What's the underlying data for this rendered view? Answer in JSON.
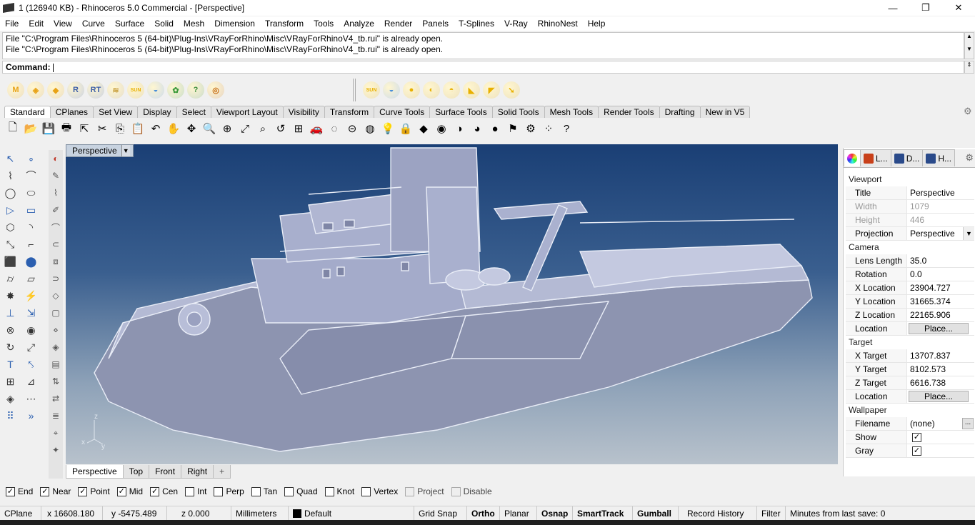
{
  "window": {
    "title": "1 (126940 KB) - Rhinoceros 5.0 Commercial - [Perspective]",
    "minimize": "—",
    "restore": "❐",
    "close": "✕"
  },
  "menu": [
    "File",
    "Edit",
    "View",
    "Curve",
    "Surface",
    "Solid",
    "Mesh",
    "Dimension",
    "Transform",
    "Tools",
    "Analyze",
    "Render",
    "Panels",
    "T-Splines",
    "V-Ray",
    "RhinoNest",
    "Help"
  ],
  "history": [
    "File \"C:\\Program Files\\Rhinoceros 5 (64-bit)\\Plug-Ins\\VRayForRhino\\Misc\\VRayForRhinoV4_tb.rui\" is already open.",
    "File \"C:\\Program Files\\Rhinoceros 5 (64-bit)\\Plug-Ins\\VRayForRhino\\Misc\\VRayForRhinoV4_tb.rui\" is already open."
  ],
  "command": {
    "label": "Command:",
    "value": ""
  },
  "plugin_toolbar_left": [
    {
      "name": "vray-m-icon",
      "glyph": "M",
      "color": "#e8a317"
    },
    {
      "name": "vray-material-icon",
      "glyph": "◈",
      "color": "#e8a317"
    },
    {
      "name": "vray-tag-icon",
      "glyph": "◆",
      "color": "#e8a317"
    },
    {
      "name": "vray-render-icon",
      "glyph": "R",
      "color": "#3d5fa8"
    },
    {
      "name": "vray-rt-icon",
      "glyph": "RT",
      "color": "#3d5fa8"
    },
    {
      "name": "vray-fur-icon",
      "glyph": "≋",
      "color": "#c8a040"
    },
    {
      "name": "vray-sun-icon",
      "glyph": "SUN",
      "color": "#e8b000"
    },
    {
      "name": "vray-dome-light-icon",
      "glyph": "◒",
      "color": "#4a8fd8"
    },
    {
      "name": "vray-proxy-icon",
      "glyph": "✿",
      "color": "#3a9a3a"
    },
    {
      "name": "vray-help-icon",
      "glyph": "?",
      "color": "#3d8f3d"
    },
    {
      "name": "vray-target-icon",
      "glyph": "◎",
      "color": "#c87018"
    }
  ],
  "plugin_toolbar_right": [
    {
      "name": "sun-icon",
      "glyph": "SUN",
      "color": "#e8b000"
    },
    {
      "name": "light-dome-icon",
      "glyph": "◒",
      "color": "#4a8fd8"
    },
    {
      "name": "sphere-light-icon",
      "glyph": "●",
      "color": "#e8b000"
    },
    {
      "name": "rect-light-icon",
      "glyph": "◐",
      "color": "#e8b000"
    },
    {
      "name": "dome-light-icon",
      "glyph": "◓",
      "color": "#e8b000"
    },
    {
      "name": "spot-light-icon",
      "glyph": "◣",
      "color": "#e8b000"
    },
    {
      "name": "ies-light-icon",
      "glyph": "◤",
      "color": "#e8b000"
    },
    {
      "name": "arrow-light-icon",
      "glyph": "➘",
      "color": "#e8b000"
    }
  ],
  "tabs": [
    "Standard",
    "CPlanes",
    "Set View",
    "Display",
    "Select",
    "Viewport Layout",
    "Visibility",
    "Transform",
    "Curve Tools",
    "Surface Tools",
    "Solid Tools",
    "Mesh Tools",
    "Render Tools",
    "Drafting",
    "New in V5"
  ],
  "main_tools": [
    {
      "name": "new-icon",
      "glyph": "🗋"
    },
    {
      "name": "open-icon",
      "glyph": "📂"
    },
    {
      "name": "save-icon",
      "glyph": "💾"
    },
    {
      "name": "print-icon",
      "glyph": "🖶"
    },
    {
      "name": "export-icon",
      "glyph": "⇱"
    },
    {
      "name": "cut-icon",
      "glyph": "✂"
    },
    {
      "name": "copy-icon",
      "glyph": "⎘"
    },
    {
      "name": "paste-icon",
      "glyph": "📋"
    },
    {
      "name": "undo-icon",
      "glyph": "↶"
    },
    {
      "name": "pan-icon",
      "glyph": "✋"
    },
    {
      "name": "rotate-view-icon",
      "glyph": "✥"
    },
    {
      "name": "zoom-icon",
      "glyph": "🔍"
    },
    {
      "name": "zoom-window-icon",
      "glyph": "⊕"
    },
    {
      "name": "zoom-extents-icon",
      "glyph": "⤢"
    },
    {
      "name": "zoom-selected-icon",
      "glyph": "⌕"
    },
    {
      "name": "undo-view-icon",
      "glyph": "↺"
    },
    {
      "name": "four-viewports-icon",
      "glyph": "⊞"
    },
    {
      "name": "car-icon",
      "glyph": "🚗"
    },
    {
      "name": "hide-icon",
      "glyph": "◌"
    },
    {
      "name": "lock-icon",
      "glyph": "⊝"
    },
    {
      "name": "layers-icon",
      "glyph": "◍"
    },
    {
      "name": "light-bulb-icon",
      "glyph": "💡"
    },
    {
      "name": "padlock-icon",
      "glyph": "🔒"
    },
    {
      "name": "material-icon",
      "glyph": "◆"
    },
    {
      "name": "color-wheel-icon",
      "glyph": "◉"
    },
    {
      "name": "shaded-sphere-icon",
      "glyph": "◑"
    },
    {
      "name": "render-sphere-icon",
      "glyph": "◕"
    },
    {
      "name": "blue-sphere-icon",
      "glyph": "●"
    },
    {
      "name": "lamp-icon",
      "glyph": "⚑"
    },
    {
      "name": "settings-icon",
      "glyph": "⚙"
    },
    {
      "name": "select-points-icon",
      "glyph": "⁘"
    },
    {
      "name": "help-icon",
      "glyph": "?"
    }
  ],
  "left_tools": [
    [
      "select-arrow-icon",
      "point-icon"
    ],
    [
      "polyline-icon",
      "curve-points-icon"
    ],
    [
      "circle-icon",
      "ellipse-icon"
    ],
    [
      "polygon-icon",
      "rectangle-icon"
    ],
    [
      "hexagon-icon",
      "arc-icon"
    ],
    [
      "curve-edit-icon",
      "fillet-icon"
    ],
    [
      "box-icon",
      "sphere-icon"
    ],
    [
      "cylinder-icon",
      "plane-icon"
    ],
    [
      "explode-icon",
      "trim-icon"
    ],
    [
      "split-icon",
      "extend-icon"
    ],
    [
      "group-icon",
      "block-icon"
    ],
    [
      "rotate-icon",
      "scale-icon"
    ],
    [
      "text-icon",
      "dimension-icon"
    ],
    [
      "array-icon",
      "analyze-icon"
    ],
    [
      "cube-icon",
      "grid-icon"
    ],
    [
      "matrix-icon",
      "more-icon"
    ]
  ],
  "left_col2": [
    "red-tool-icon",
    "pen-icon",
    "knot-icon",
    "edit-icon",
    "blend-icon",
    "match-icon",
    "offset-icon",
    "project-icon",
    "surface-icon",
    "solid-icon",
    "mesh-icon",
    "render-icon",
    "doc-icon",
    "align-icon",
    "move-icon",
    "zebra-icon",
    "camera-icon",
    "light-icon"
  ],
  "viewport": {
    "name": "Perspective",
    "axis": {
      "z": "z",
      "x": "x",
      "y": "y"
    }
  },
  "viewport_tabs": [
    "Perspective",
    "Top",
    "Front",
    "Right",
    "+"
  ],
  "right_panel": {
    "tabs": [
      {
        "name": "properties-tab",
        "label": "",
        "color": "#e8a317"
      },
      {
        "name": "layers-tab",
        "label": "L...",
        "color": "#c8401a"
      },
      {
        "name": "display-tab",
        "label": "D...",
        "color": "#2a4a8a"
      },
      {
        "name": "help-tab",
        "label": "H...",
        "color": "#2a4a8a"
      }
    ],
    "viewport_section": "Viewport",
    "viewport_rows": [
      {
        "key": "Title",
        "value": "Perspective",
        "dim": false
      },
      {
        "key": "Width",
        "value": "1079",
        "dim": true
      },
      {
        "key": "Height",
        "value": "446",
        "dim": true
      },
      {
        "key": "Projection",
        "value": "Perspective",
        "dim": false,
        "dropdown": true
      }
    ],
    "camera_section": "Camera",
    "camera_rows": [
      {
        "key": "Lens Length",
        "value": "35.0"
      },
      {
        "key": "Rotation",
        "value": "0.0"
      },
      {
        "key": "X Location",
        "value": "23904.727"
      },
      {
        "key": "Y Location",
        "value": "31665.374"
      },
      {
        "key": "Z Location",
        "value": "22165.906"
      },
      {
        "key": "Location",
        "button": "Place..."
      }
    ],
    "target_section": "Target",
    "target_rows": [
      {
        "key": "X Target",
        "value": "13707.837"
      },
      {
        "key": "Y Target",
        "value": "8102.573"
      },
      {
        "key": "Z Target",
        "value": "6616.738"
      },
      {
        "key": "Location",
        "button": "Place..."
      }
    ],
    "wallpaper_section": "Wallpaper",
    "wallpaper_rows": [
      {
        "key": "Filename",
        "value": "(none)",
        "browse": "..."
      },
      {
        "key": "Show",
        "checked": true
      },
      {
        "key": "Gray",
        "checked": true
      }
    ]
  },
  "osnap": [
    {
      "label": "End",
      "checked": true
    },
    {
      "label": "Near",
      "checked": true
    },
    {
      "label": "Point",
      "checked": true
    },
    {
      "label": "Mid",
      "checked": true
    },
    {
      "label": "Cen",
      "checked": true
    },
    {
      "label": "Int",
      "checked": false
    },
    {
      "label": "Perp",
      "checked": false
    },
    {
      "label": "Tan",
      "checked": false
    },
    {
      "label": "Quad",
      "checked": false
    },
    {
      "label": "Knot",
      "checked": false
    },
    {
      "label": "Vertex",
      "checked": false
    },
    {
      "label": "Project",
      "checked": false,
      "disabled": true
    },
    {
      "label": "Disable",
      "checked": false,
      "disabled": true
    }
  ],
  "status": {
    "cplane": "CPlane",
    "x": "x 16608.180",
    "y": "y -5475.489",
    "z": "z 0.000",
    "units": "Millimeters",
    "layer": "Default",
    "grid_snap": "Grid Snap",
    "ortho": "Ortho",
    "planar": "Planar",
    "osnap": "Osnap",
    "smarttrack": "SmartTrack",
    "gumball": "Gumball",
    "record_history": "Record History",
    "filter": "Filter",
    "autosave": "Minutes from last save: 0"
  }
}
